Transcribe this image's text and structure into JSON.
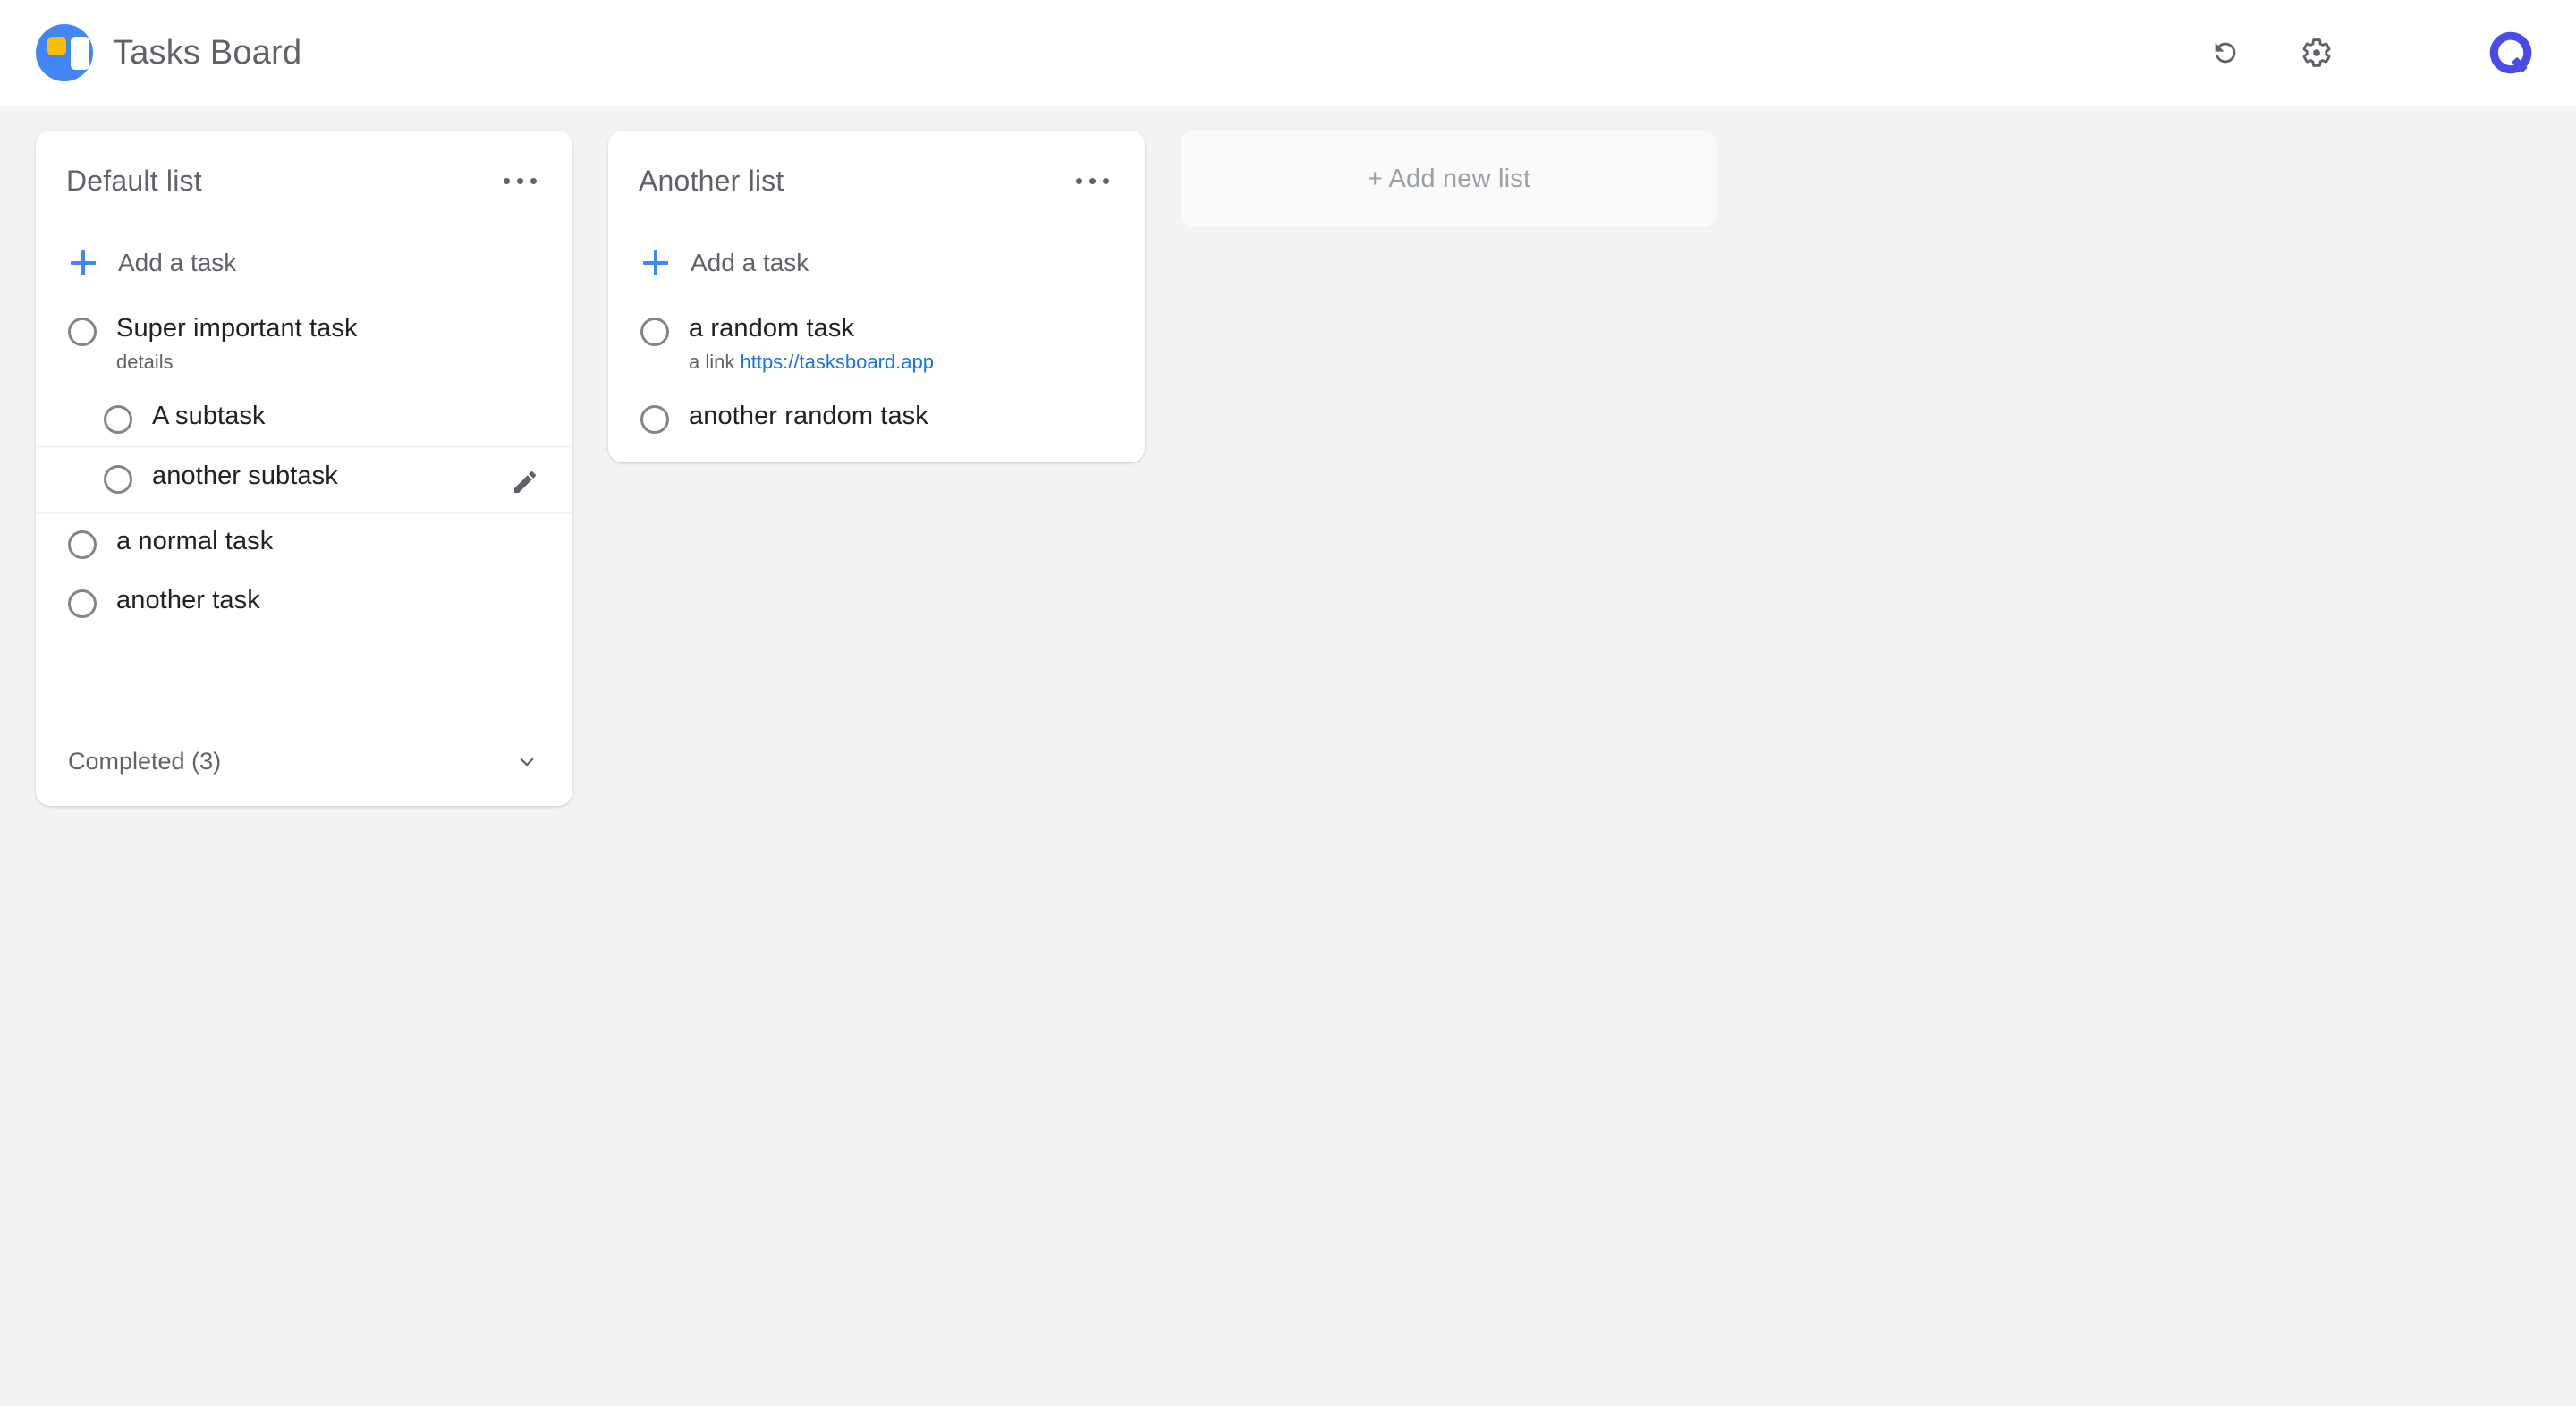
{
  "header": {
    "app_title": "Tasks Board",
    "logo_icon": "tasks-board-logo",
    "actions": [
      {
        "name": "refresh-button",
        "icon": "refresh-icon"
      },
      {
        "name": "settings-button",
        "icon": "gear-icon"
      }
    ],
    "brand_badge_icon": "q-circle-logo"
  },
  "colors": {
    "page_background": "#f1f3f4",
    "card_background": "#ffffff",
    "accent_blue": "#4285f4",
    "link_blue": "#1a73e8",
    "logo_yellow": "#fbbc04",
    "text_primary": "#202124",
    "text_secondary": "#5f6368",
    "muted": "#9aa0a6",
    "brand_badge": "#4a4ae8"
  },
  "board": {
    "add_list_label": "+ Add new list",
    "lists": [
      {
        "title": "Default list",
        "menu_icon": "more-options-icon",
        "add_task_label": "Add a task",
        "tasks": [
          {
            "title": "Super important task",
            "detail": "details",
            "sub": false,
            "hovered": false
          },
          {
            "title": "A subtask",
            "detail": "",
            "sub": true,
            "hovered": false
          },
          {
            "title": "another subtask",
            "detail": "",
            "sub": true,
            "hovered": true
          },
          {
            "title": "a normal task",
            "detail": "",
            "sub": false,
            "hovered": false
          },
          {
            "title": "another task",
            "detail": "",
            "sub": false,
            "hovered": false
          }
        ],
        "completed_label": "Completed (3)",
        "completed_icon": "chevron-down-icon"
      },
      {
        "title": "Another list",
        "menu_icon": "more-options-icon",
        "add_task_label": "Add a task",
        "tasks": [
          {
            "title": "a random task",
            "detail": "a link ",
            "detail_link": "https://tasksboard.app",
            "sub": false,
            "hovered": false
          },
          {
            "title": "another random task",
            "detail": "",
            "sub": false,
            "hovered": false
          }
        ]
      }
    ]
  }
}
